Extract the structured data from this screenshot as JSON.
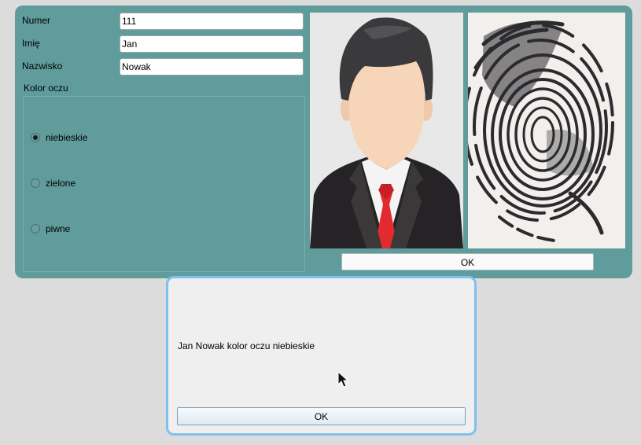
{
  "form": {
    "numer_label": "Numer",
    "numer_value": "111",
    "imie_label": "Imię",
    "imie_value": "Jan",
    "nazwisko_label": "Nazwisko",
    "nazwisko_value": "Nowak",
    "eye_color": {
      "title": "Kolor oczu",
      "options": [
        {
          "label": "niebieskie",
          "checked": true
        },
        {
          "label": "zielone",
          "checked": false
        },
        {
          "label": "piwne",
          "checked": false
        }
      ]
    },
    "ok_label": "OK"
  },
  "images": {
    "photo_icon": "person-portrait-icon",
    "fingerprint_icon": "fingerprint-icon"
  },
  "dialog": {
    "message": "Jan Nowak kolor oczu niebieskie",
    "ok_label": "OK"
  },
  "colors": {
    "panel": "#5f9c9b",
    "dialog_border": "#7fc0ee",
    "background": "#dcdcdc"
  }
}
